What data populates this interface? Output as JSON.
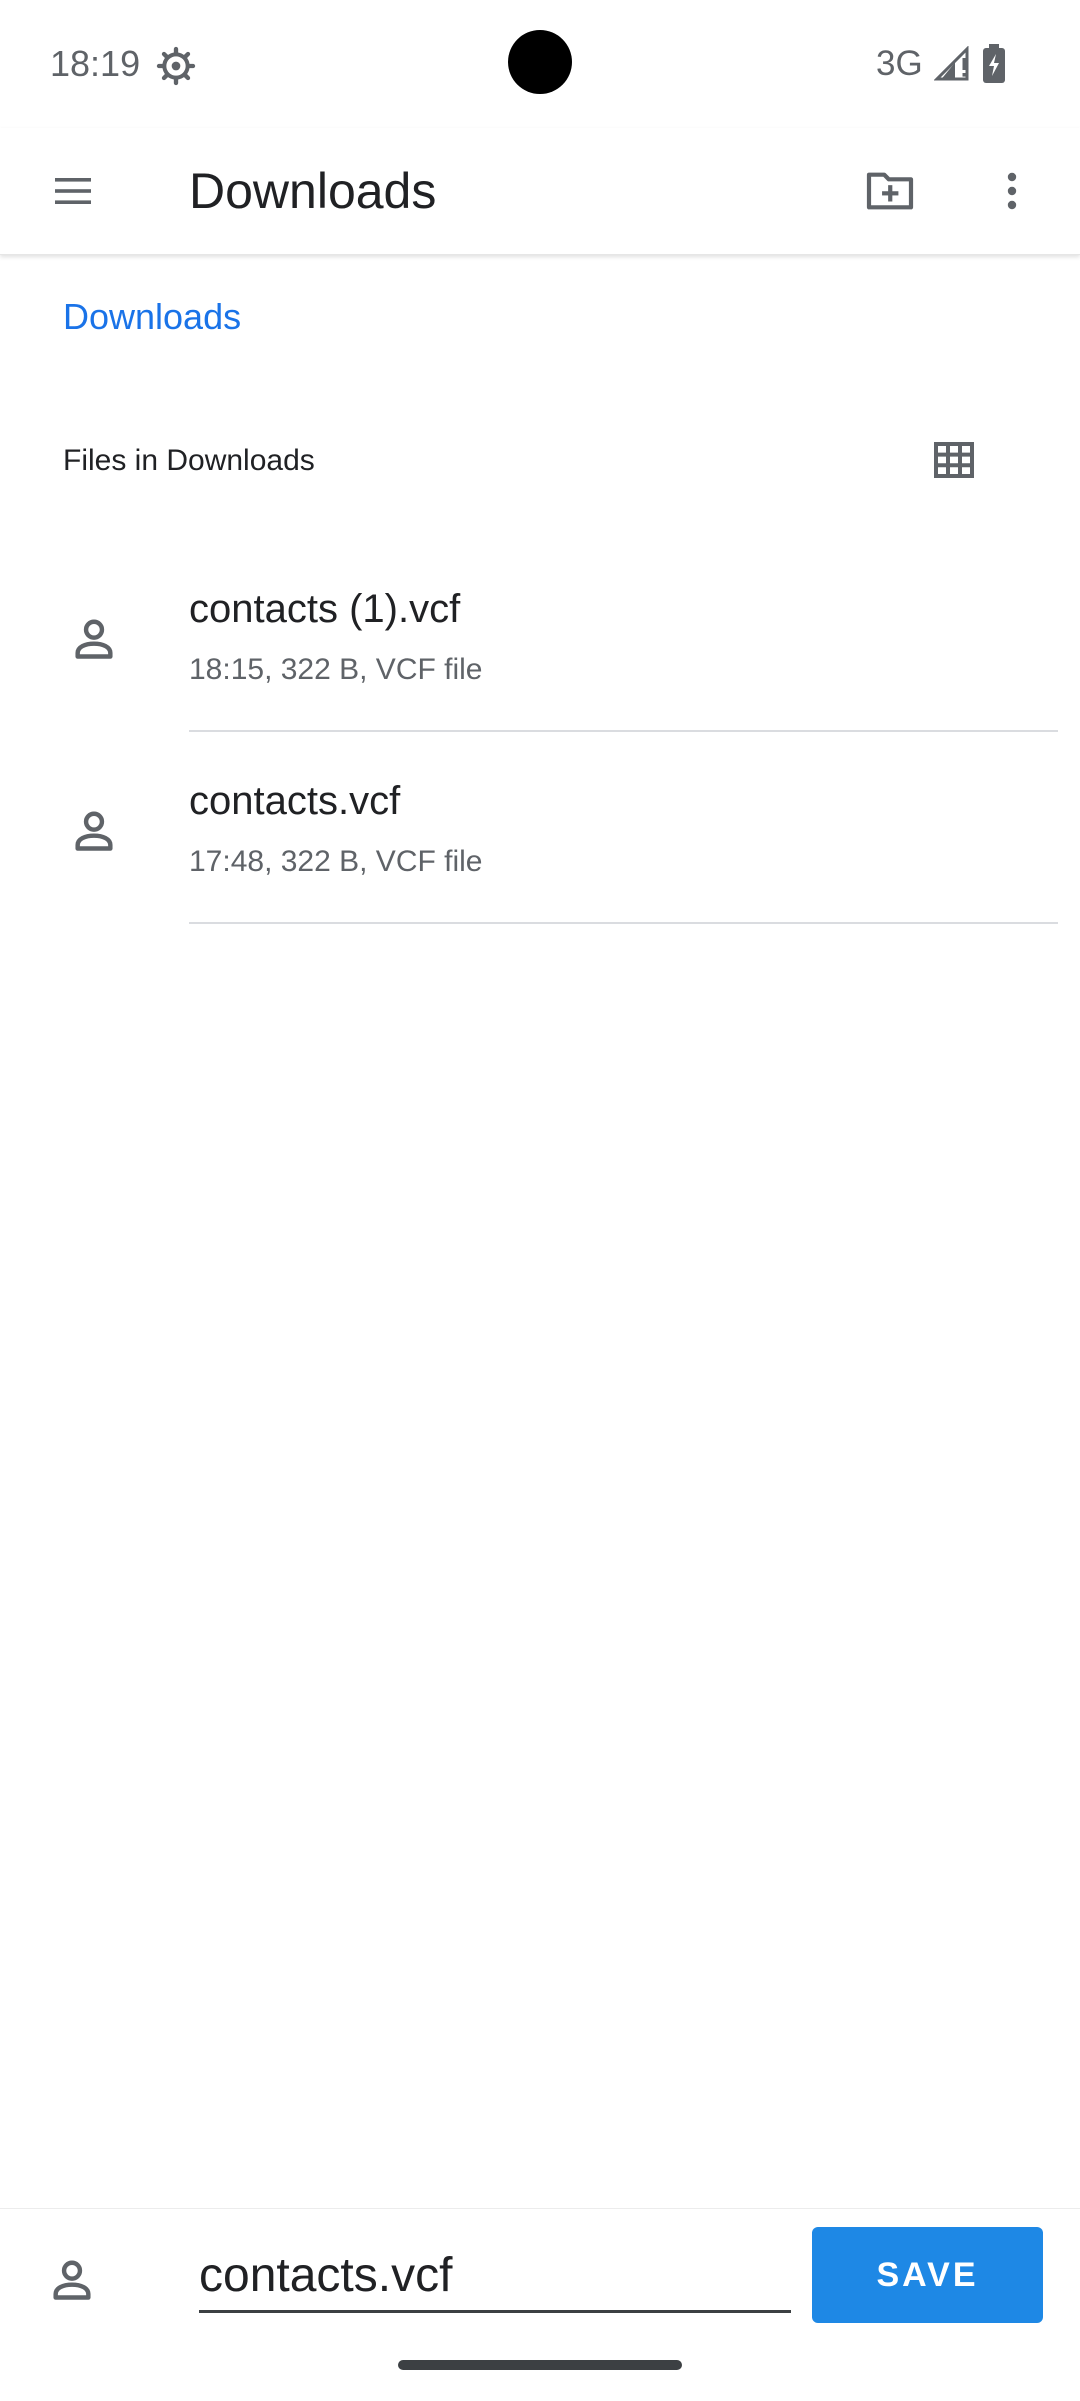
{
  "status_bar": {
    "time": "18:19",
    "network": "3G",
    "icons": [
      "settings-gear-icon",
      "signal-icon",
      "battery-charging-icon"
    ]
  },
  "app_bar": {
    "title": "Downloads",
    "icons": [
      "menu-icon",
      "new-folder-icon",
      "more-vert-icon"
    ]
  },
  "breadcrumb": {
    "label": "Downloads"
  },
  "section": {
    "title": "Files in Downloads",
    "view_toggle_icon": "grid-view-icon"
  },
  "files": [
    {
      "name": "contacts (1).vcf",
      "meta": "18:15, 322 B, VCF file",
      "icon": "contact-file-icon"
    },
    {
      "name": "contacts.vcf",
      "meta": "17:48, 322 B, VCF file",
      "icon": "contact-file-icon"
    }
  ],
  "save_bar": {
    "filename_value": "contacts.vcf",
    "save_label": "SAVE",
    "icon": "contact-file-icon"
  },
  "colors": {
    "accent": "#1a73e8",
    "save_button": "#1e88e5",
    "icon_gray": "#5f6368"
  }
}
